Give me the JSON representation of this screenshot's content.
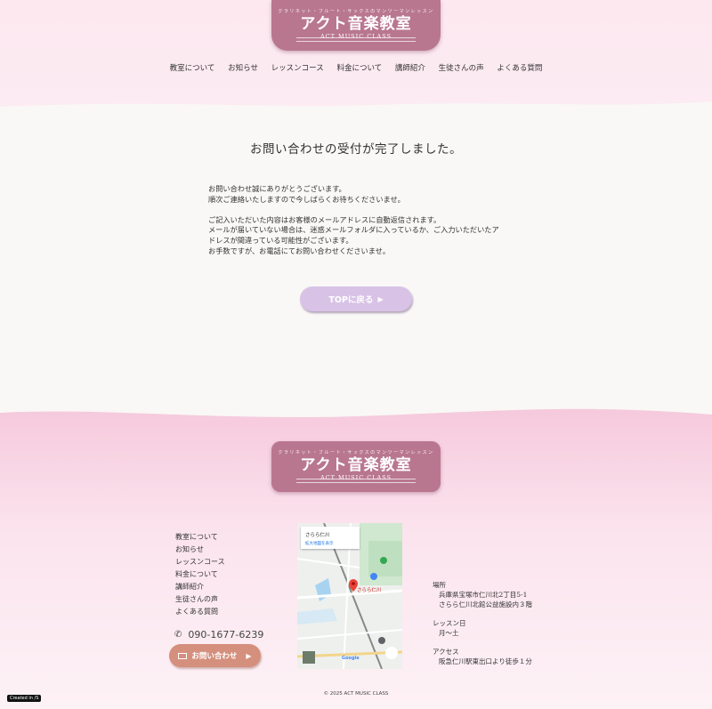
{
  "brand": {
    "tagline": "クラリネット・フルート・サックスのマンツーマンレッスン",
    "name": "アクト音楽教室",
    "name_en": "ACT MUSIC CLASS",
    "color": "#b9778f"
  },
  "nav": [
    "教室について",
    "お知らせ",
    "レッスンコース",
    "料金について",
    "講師紹介",
    "生徒さんの声",
    "よくある質問"
  ],
  "page": {
    "title": "お問い合わせの受付が完了しました。",
    "paragraph1_line1": "お問い合わせ誠にありがとうございます。",
    "paragraph1_line2": "順次ご連絡いたしますので今しばらくお待ちくださいませ。",
    "paragraph2_line1": "ご記入いただいた内容はお客様のメールアドレスに自動返信されます。",
    "paragraph2_line2": "メールが届いていない場合は、迷惑メールフォルダに入っているか、ご入力いただいたア",
    "paragraph2_line3": "ドレスが間違っている可能性がございます。",
    "paragraph2_line4": "お手数ですが、お電話にてお問い合わせくださいませ。",
    "back_button": "TOPに戻る",
    "button_color": "#d8c3e6"
  },
  "footer": {
    "nav": [
      "教室について",
      "お知らせ",
      "レッスンコース",
      "料金について",
      "講師紹介",
      "生徒さんの声",
      "よくある質問"
    ],
    "phone": "090-1677-6239",
    "contact_button": "お問い合わせ",
    "contact_color": "#d58f7d",
    "map": {
      "place": "さらら仁川",
      "link": "拡大地図を表示",
      "pin_label": "さらら仁川",
      "google": "Google"
    },
    "info": {
      "location_label": "場所",
      "location_line1": "兵庫県宝塚市仁川北2丁目5-1",
      "location_line2": "さらら仁川北館公益施設内３階",
      "days_label": "レッスン日",
      "days_value": "月～土",
      "access_label": "アクセス",
      "access_value": "阪急仁川駅東出口より徒歩１分"
    },
    "copyright": "© 2025 ACT MUSIC CLASS"
  },
  "badge": "Created in /S"
}
